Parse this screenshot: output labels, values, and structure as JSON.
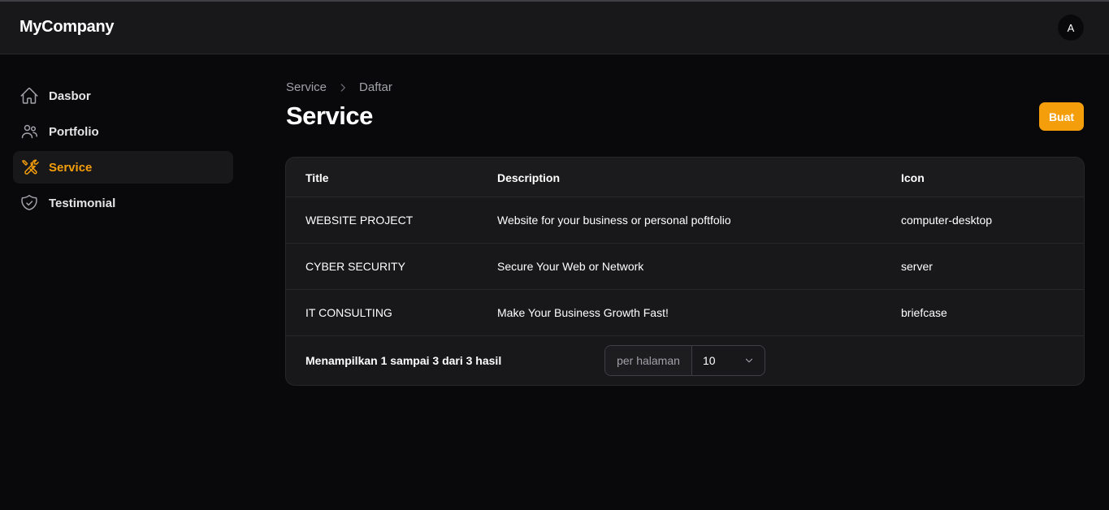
{
  "app": {
    "brand": "MyCompany",
    "avatar_initial": "A"
  },
  "sidebar": {
    "items": [
      {
        "label": "Dasbor",
        "icon": "home-icon",
        "active": false
      },
      {
        "label": "Portfolio",
        "icon": "users-icon",
        "active": false
      },
      {
        "label": "Service",
        "icon": "wrench-screwdriver-icon",
        "active": true
      },
      {
        "label": "Testimonial",
        "icon": "shield-check-icon",
        "active": false
      }
    ]
  },
  "breadcrumb": {
    "parent": "Service",
    "current": "Daftar"
  },
  "page": {
    "title": "Service",
    "create_label": "Buat"
  },
  "table": {
    "headers": {
      "title": "Title",
      "description": "Description",
      "icon": "Icon"
    },
    "rows": [
      {
        "title": "WEBSITE PROJECT",
        "description": "Website for your business or personal poftfolio",
        "icon": "computer-desktop"
      },
      {
        "title": "CYBER SECURITY",
        "description": "Secure Your Web or Network",
        "icon": "server"
      },
      {
        "title": "IT CONSULTING",
        "description": "Make Your Business Growth Fast!",
        "icon": "briefcase"
      }
    ]
  },
  "pagination": {
    "summary": "Menampilkan 1 sampai 3 dari 3 hasil",
    "per_page_label": "per halaman",
    "per_page_value": "10"
  },
  "colors": {
    "accent": "#f59e0b",
    "background": "#09090b",
    "surface": "#18181b"
  }
}
